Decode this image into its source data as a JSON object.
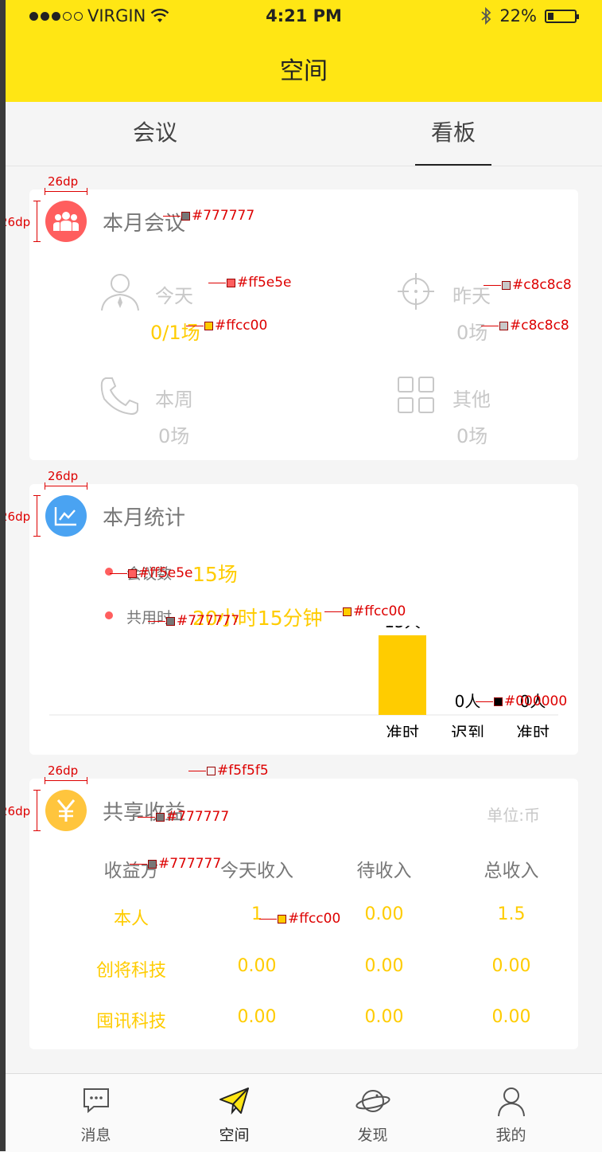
{
  "status_bar": {
    "carrier": "VIRGIN",
    "time": "4:21 PM",
    "battery": "22%",
    "battery_level": 0.22
  },
  "nav": {
    "title": "空间"
  },
  "tabs": [
    {
      "label": "会议",
      "active": false
    },
    {
      "label": "看板",
      "active": true
    }
  ],
  "dimension_label": "26dp",
  "meeting_card": {
    "title": "本月会议",
    "items": [
      {
        "title": "今天",
        "value": "0/1场",
        "icon": "person-icon",
        "highlight": true
      },
      {
        "title": "昨天",
        "value": "0场",
        "icon": "crosshair-icon",
        "highlight": false
      },
      {
        "title": "本周",
        "value": "0场",
        "icon": "phone-icon",
        "highlight": false
      },
      {
        "title": "其他",
        "value": "0场",
        "icon": "grid-icon",
        "highlight": false
      }
    ]
  },
  "stats_card": {
    "title": "本月统计",
    "meeting_count_label": "会议数",
    "meeting_count_value": "15场",
    "duration_label": "共用时",
    "duration_value": "20小时15分钟"
  },
  "chart_data": {
    "type": "bar",
    "categories": [
      "准时",
      "迟到",
      "准时"
    ],
    "values": [
      15,
      0,
      0
    ],
    "data_labels": [
      "15人",
      "0人",
      "0人"
    ],
    "bar_color": "#ffcc00"
  },
  "earnings_card": {
    "title": "共享收益",
    "unit": "单位:币",
    "headers": [
      "收益方",
      "今天收入",
      "待收入",
      "总收入"
    ],
    "rows": [
      [
        "本人",
        "1",
        "0.00",
        "1.5"
      ],
      [
        "创将科技",
        "0.00",
        "0.00",
        "0.00"
      ],
      [
        "囤讯科技",
        "0.00",
        "0.00",
        "0.00"
      ]
    ]
  },
  "annotations": {
    "c777": "#777777",
    "cff5e5e": "#ff5e5e",
    "cffcc00": "#ffcc00",
    "cc8c8c8": "#c8c8c8",
    "cf5f5f5": "#f5f5f5",
    "c000000": "#000000"
  },
  "bottom_nav": [
    {
      "label": "消息",
      "icon": "chat-icon",
      "active": false
    },
    {
      "label": "空间",
      "icon": "paper-plane-icon",
      "active": true
    },
    {
      "label": "发现",
      "icon": "planet-icon",
      "active": false
    },
    {
      "label": "我的",
      "icon": "user-icon",
      "active": false
    }
  ],
  "colors": {
    "header": "#ffe614",
    "accent": "#ffcc00",
    "red": "#ff5e5e",
    "gray_text": "#777777",
    "light_gray": "#c8c8c8",
    "background": "#f5f5f5"
  }
}
